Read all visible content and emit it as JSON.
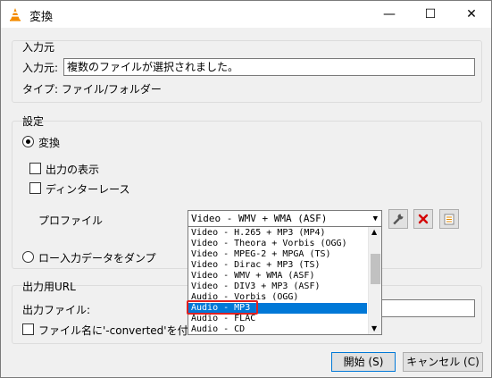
{
  "window": {
    "title": "変換",
    "minimize_glyph": "—",
    "maximize_glyph": "☐",
    "close_glyph": "✕"
  },
  "source": {
    "group_title": "入力元",
    "input_label": "入力元:",
    "input_value": "複数のファイルが選択されました。",
    "type_label": "タイプ: ファイル/フォルダー"
  },
  "settings": {
    "group_title": "設定",
    "convert_label": "変換",
    "show_output_label": "出力の表示",
    "deinterlace_label": "ディンターレース",
    "profile_label": "プロファイル",
    "profile_value": "Video - WMV + WMA (ASF)",
    "dump_label": "ロー入力データをダンプ"
  },
  "profile_options": [
    "Video - H.265 + MP3 (MP4)",
    "Video - Theora + Vorbis (OGG)",
    "Video - MPEG-2 + MPGA (TS)",
    "Video - Dirac + MP3 (TS)",
    "Video - WMV + WMA (ASF)",
    "Video - DIV3 + MP3 (ASF)",
    "Audio - Vorbis (OGG)",
    "Audio - MP3",
    "Audio - FLAC",
    "Audio - CD"
  ],
  "selected_option": "Audio - MP3",
  "destination": {
    "group_title": "出力用URL",
    "file_label": "出力ファイル:",
    "suffix_label": "ファイル名に'-converted'を付"
  },
  "buttons": {
    "start": "開始 (S)",
    "cancel": "キャンセル (C)"
  },
  "colors": {
    "selection": "#0078d7",
    "highlight_box": "#e02020",
    "delete_red": "#d40000",
    "vlc_orange": "#f48b00"
  },
  "icons": [
    "vlc-cone-icon",
    "wrench-icon",
    "delete-icon",
    "new-profile-icon"
  ]
}
